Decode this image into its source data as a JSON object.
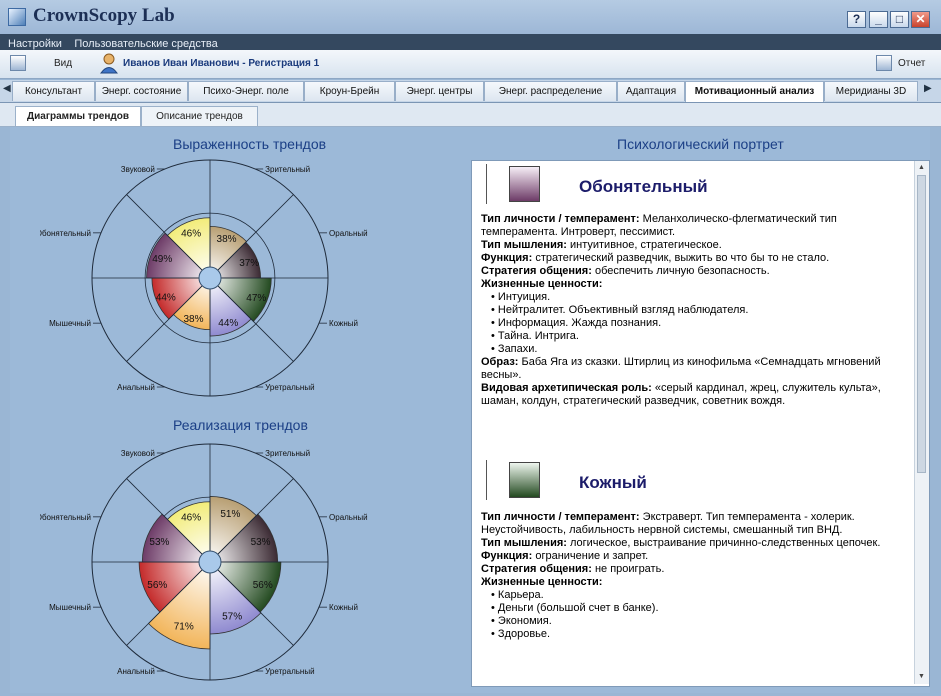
{
  "app": {
    "title": "CrownScopy Lab",
    "help": "?"
  },
  "menu": {
    "items": [
      "Настройки",
      "Пользовательские средства"
    ]
  },
  "toolbar": {
    "view_label": "Вид",
    "user": "Иванов Иван Иванович - Регистрация 1",
    "report_label": "Отчет"
  },
  "tabs": [
    "Консультант",
    "Энерг. состояние",
    "Психо-Энерг. поле",
    "Кроун-Брейн",
    "Энерг. центры",
    "Энерг. распределение",
    "Адаптация",
    "Мотивационный анализ",
    "Меридианы 3D"
  ],
  "subtabs": [
    "Диаграммы трендов",
    "Описание трендов"
  ],
  "left": {
    "title1": "Выраженность трендов",
    "title2": "Реализация трендов"
  },
  "right": {
    "title": "Психологический портрет"
  },
  "colors": {
    "zritelny": "#b89f73",
    "oralny": "#3b2a33",
    "kozhny": "#234a20",
    "uretralny": "#8f8ad0",
    "analny": "#f2b55a",
    "myshechny": "#c42a2a",
    "obonyatelny": "#6d3b67",
    "zvukovoy": "#f2ec7a"
  },
  "chart_data": [
    {
      "type": "pie",
      "title": "Выраженность трендов",
      "categories": [
        "Зрительный",
        "Оральный",
        "Кожный",
        "Уретральный",
        "Анальный",
        "Мышечный",
        "Обонятельный",
        "Звуковой"
      ],
      "values": [
        38,
        37,
        47,
        44,
        38,
        44,
        49,
        46
      ],
      "labels": [
        "38%",
        "37%",
        "47%",
        "44%",
        "38%",
        "44%",
        "49%",
        "46%"
      ]
    },
    {
      "type": "pie",
      "title": "Реализация трендов",
      "categories": [
        "Зрительный",
        "Оральный",
        "Кожный",
        "Уретральный",
        "Анальный",
        "Мышечный",
        "Обонятельный",
        "Звуковой"
      ],
      "values": [
        51,
        53,
        56,
        57,
        71,
        56,
        53,
        46
      ],
      "labels": [
        "51%",
        "53%",
        "56%",
        "57%",
        "71%",
        "56%",
        "53%",
        "46%"
      ]
    }
  ],
  "portrait": {
    "type1": {
      "name": "Обонятельный",
      "temp_label": "Тип личности / темперамент:",
      "temp": "Меланхолическо-флегматический тип темперамента. Интроверт, пессимист.",
      "think_label": "Тип мышления:",
      "think": "интуитивное, стратегическое.",
      "func_label": "Функция:",
      "func": "стратегический разведчик, выжить во что бы то не стало.",
      "strat_label": "Стратегия общения:",
      "strat": "обеспечить личную безопасность.",
      "values_label": "Жизненные ценности:",
      "values": [
        "Интуиция.",
        "Нейтралитет. Объективный взгляд наблюдателя.",
        "Информация. Жажда познания.",
        "Тайна. Интрига.",
        "Запахи."
      ],
      "image_label": "Образ:",
      "image": "Баба Яга из сказки. Штирлиц из кинофильма «Семнадцать мгновений весны».",
      "role_label": "Видовая архетипическая роль:",
      "role": "«серый кардинал, жрец, служитель культа», шаман, колдун, стратегический разведчик, советник вождя."
    },
    "type2": {
      "name": "Кожный",
      "temp_label": "Тип личности / темперамент:",
      "temp": "Экстраверт. Тип темперамента - холерик. Неустойчивость, лабильность нервной системы, смешанный тип ВНД.",
      "think_label": "Тип мышления:",
      "think": "логическое, выстраивание причинно-следственных цепочек.",
      "func_label": "Функция:",
      "func": "ограничение и запрет.",
      "strat_label": "Стратегия общения:",
      "strat": "не проиграть.",
      "values_label": "Жизненные ценности:",
      "values": [
        "Карьера.",
        "Деньги (большой счет в банке).",
        "Экономия.",
        "Здоровье."
      ]
    }
  }
}
